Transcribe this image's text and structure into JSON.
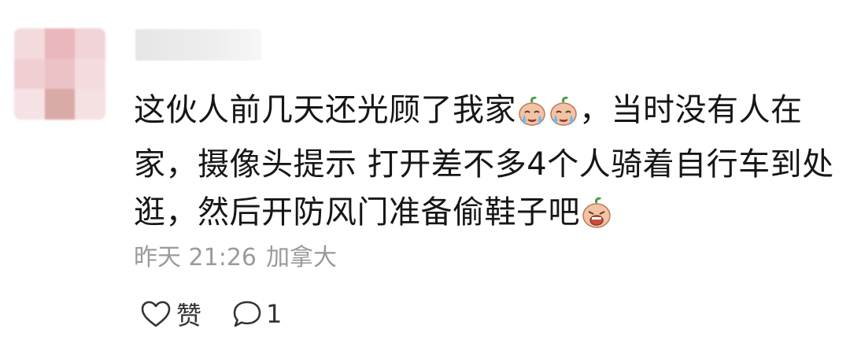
{
  "comment": {
    "username": "",
    "text_line1": "这伙人前几天还光顾了我家",
    "text_line1_rest": "，当时没有人在",
    "text_line2": "家，摄像头提示 打开差不多4个人骑着自行车到处",
    "text_line3": "逛，然后开防风门准备偷鞋子吧",
    "emojis": [
      "crying-emoji",
      "crying-emoji",
      "crying-face-emoji"
    ],
    "timestamp": "昨天 21:26",
    "location": "加拿大",
    "like_label": "赞",
    "reply_count": "1"
  },
  "colors": {
    "text": "#161616",
    "meta": "#9a9a9a",
    "icon": "#333333"
  }
}
